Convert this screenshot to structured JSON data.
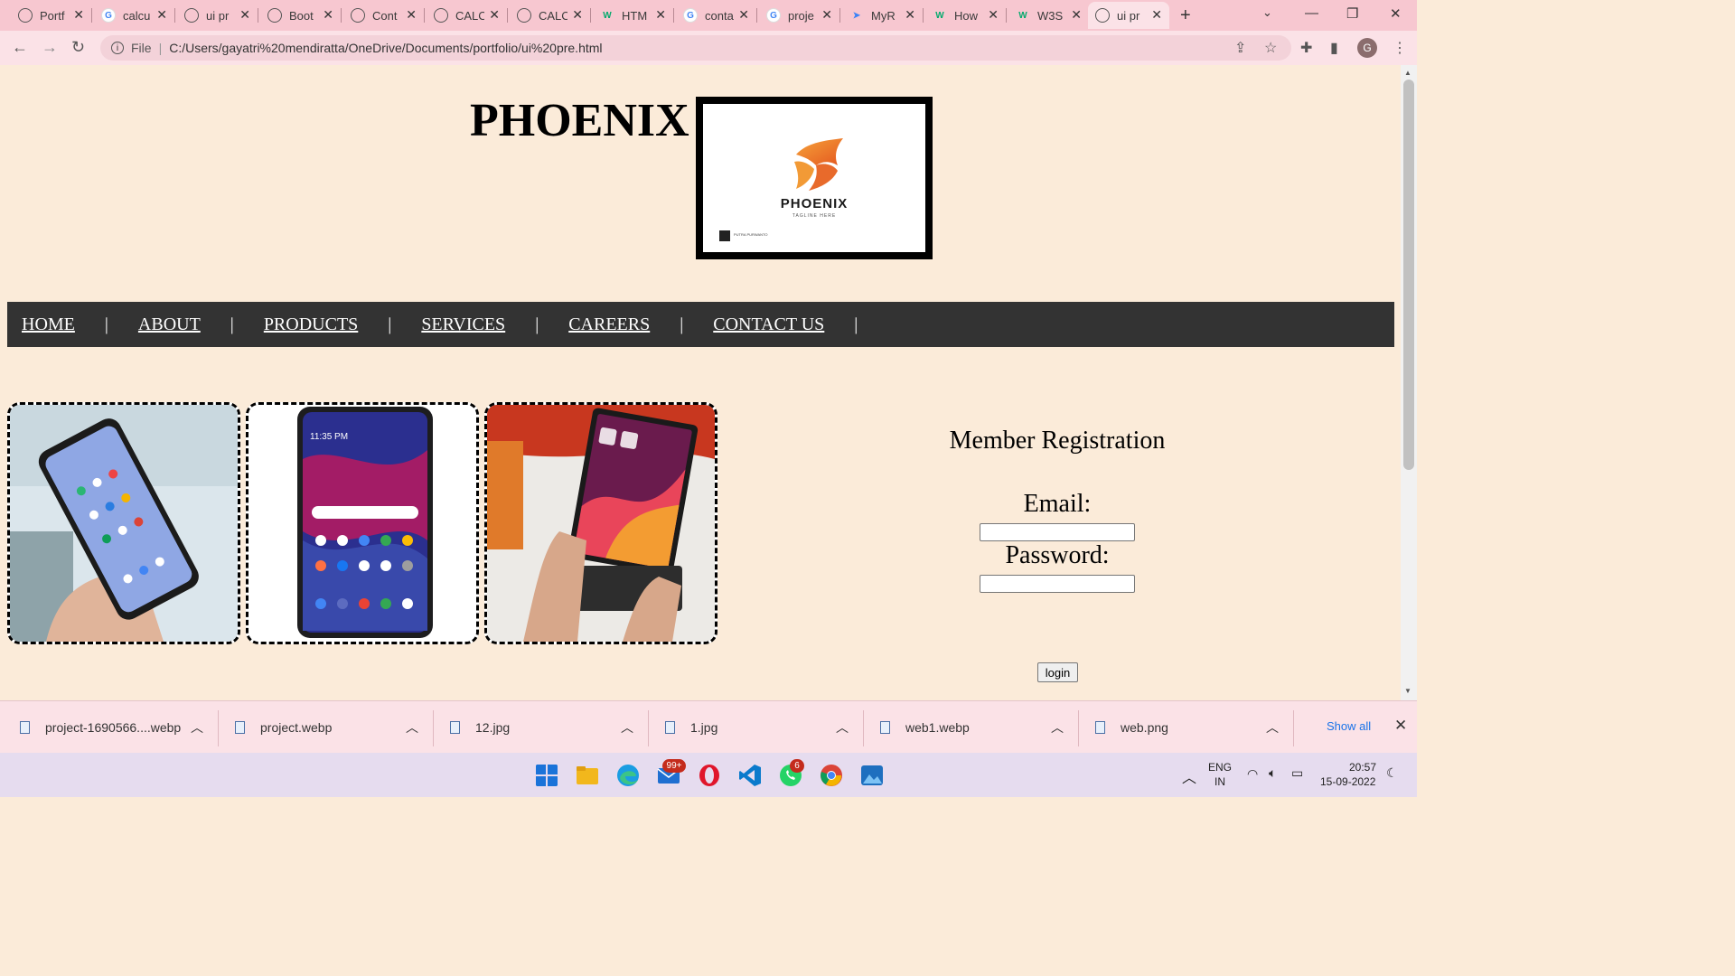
{
  "browser": {
    "tabs": [
      {
        "title": "Portf",
        "icon": "globe-icon"
      },
      {
        "title": "calcu",
        "icon": "google-icon"
      },
      {
        "title": "ui pr",
        "icon": "globe-icon"
      },
      {
        "title": "Boot",
        "icon": "globe-icon"
      },
      {
        "title": "Cont",
        "icon": "globe-icon"
      },
      {
        "title": "CALC",
        "icon": "globe-icon"
      },
      {
        "title": "CALC",
        "icon": "globe-icon"
      },
      {
        "title": "HTM",
        "icon": "w3schools-icon"
      },
      {
        "title": "conta",
        "icon": "google-icon"
      },
      {
        "title": "proje",
        "icon": "google-icon"
      },
      {
        "title": "MyR",
        "icon": "myr-icon"
      },
      {
        "title": "How",
        "icon": "w3schools-icon"
      },
      {
        "title": "W3S",
        "icon": "w3schools-icon"
      },
      {
        "title": "ui pr",
        "icon": "globe-icon",
        "active": true
      }
    ],
    "address": {
      "scheme_label": "File",
      "url": "C:/Users/gayatri%20mendiratta/OneDrive/Documents/portfolio/ui%20pre.html"
    },
    "profile_initial": "G"
  },
  "page": {
    "brand_title": "PHOENIX",
    "logo": {
      "name": "PHOENIX",
      "tagline": "TAGLINE HERE",
      "credit": "PUTRA PURWANTO"
    },
    "nav": [
      "HOME",
      "ABOUT",
      "PRODUCTS",
      "SERVICES",
      "CAREERS",
      "CONTACT US"
    ],
    "nav_separator": "|",
    "registration": {
      "title": "Member Registration",
      "email_label": "Email:",
      "password_label": "Password:",
      "email_value": "",
      "password_value": "",
      "login_label": "login"
    }
  },
  "downloads": {
    "items": [
      "project-1690566....webp",
      "project.webp",
      "12.jpg",
      "1.jpg",
      "web1.webp",
      "web.png"
    ],
    "show_all_label": "Show all"
  },
  "taskbar": {
    "mail_badge": "99+",
    "whatsapp_badge": "6",
    "language": "ENG",
    "region": "IN",
    "time": "20:57",
    "date": "15-09-2022"
  },
  "colors": {
    "page_background": "#fbebd9",
    "nav_background": "#333333",
    "tabstrip": "#f7c7d0",
    "accent_link": "#1a73e8"
  }
}
